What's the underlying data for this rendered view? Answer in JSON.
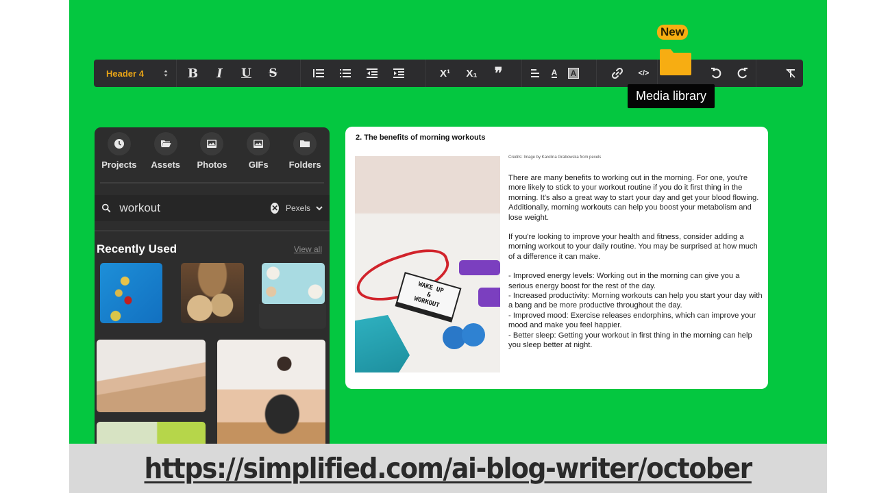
{
  "toolbar": {
    "heading_select": "Header 4",
    "heading_arrows": "⇕",
    "buttons": [
      {
        "name": "bold",
        "glyph": "B"
      },
      {
        "name": "italic",
        "glyph": "I"
      },
      {
        "name": "underline",
        "glyph": "U"
      },
      {
        "name": "strikethrough",
        "glyph": "S"
      },
      {
        "name": "ordered-list",
        "glyph": "≡"
      },
      {
        "name": "bullet-list",
        "glyph": "☰"
      },
      {
        "name": "outdent",
        "glyph": "⇤"
      },
      {
        "name": "indent",
        "glyph": "⇥"
      },
      {
        "name": "superscript",
        "glyph": "X¹"
      },
      {
        "name": "subscript",
        "glyph": "X₁"
      },
      {
        "name": "blockquote",
        "glyph": "❞"
      },
      {
        "name": "align",
        "glyph": "≡"
      },
      {
        "name": "text-color",
        "glyph": "A"
      },
      {
        "name": "highlight",
        "glyph": "A"
      },
      {
        "name": "link",
        "glyph": "🔗"
      },
      {
        "name": "code",
        "glyph": "</>"
      },
      {
        "name": "undo",
        "glyph": "↺"
      },
      {
        "name": "redo",
        "glyph": "↻"
      },
      {
        "name": "clear-format",
        "glyph": "T̸"
      }
    ],
    "media_badge": "New",
    "media_tooltip": "Media library",
    "accent_color": "#f7ad12"
  },
  "panel": {
    "categories": [
      {
        "label": "Projects",
        "icon": "clock-icon"
      },
      {
        "label": "Assets",
        "icon": "open-folder-icon"
      },
      {
        "label": "Photos",
        "icon": "image-icon"
      },
      {
        "label": "GIFs",
        "icon": "gif-image-icon"
      },
      {
        "label": "Folders",
        "icon": "folder-icon"
      }
    ],
    "search": {
      "value": "workout",
      "source": "Pexels"
    },
    "recent_title": "Recently Used",
    "view_all": "View all",
    "thumbnails": [
      {
        "alt": "Chili pepper and lime slices on blue"
      },
      {
        "alt": "Tacos on a plate"
      },
      {
        "alt": "Salad bowls on light blue table"
      },
      {
        "alt": "Woman doing pilates in living room"
      },
      {
        "alt": "Woman stretching on floor"
      },
      {
        "alt": "Green curtain room"
      }
    ]
  },
  "document": {
    "heading": "2. The benefits of morning workouts",
    "credits": "Credits: Image by Karolina Grabowska from pexels",
    "image_sign": [
      "WAKE UP",
      "&",
      "WORKOUT"
    ],
    "paragraphs": [
      "There are many benefits to working out in the morning. For one, you're more likely to stick to your workout routine if you do it first thing in the morning. It's also a great way to start your day and get your blood flowing. Additionally, morning workouts can help you boost your metabolism and lose weight.",
      "If you're looking to improve your health and fitness, consider adding a morning workout to your daily routine. You may be surprised at how much of a difference it can make."
    ],
    "bullets": [
      "- Improved energy levels: Working out in the morning can give you a serious energy boost for the rest of the day.",
      "- Increased productivity: Morning workouts can help you start your day with a bang and be more productive throughout the day.",
      "- Improved mood: Exercise releases endorphins, which can improve your mood and make you feel happier.",
      "- Better sleep: Getting your workout in first thing in the morning can help you sleep better at night."
    ]
  },
  "caption": {
    "url": "https://simplified.com/ai-blog-writer/october"
  },
  "colors": {
    "background_green": "#04c740",
    "toolbar_dark": "#2c2c2e",
    "caption_gray": "#d9d9d9"
  }
}
